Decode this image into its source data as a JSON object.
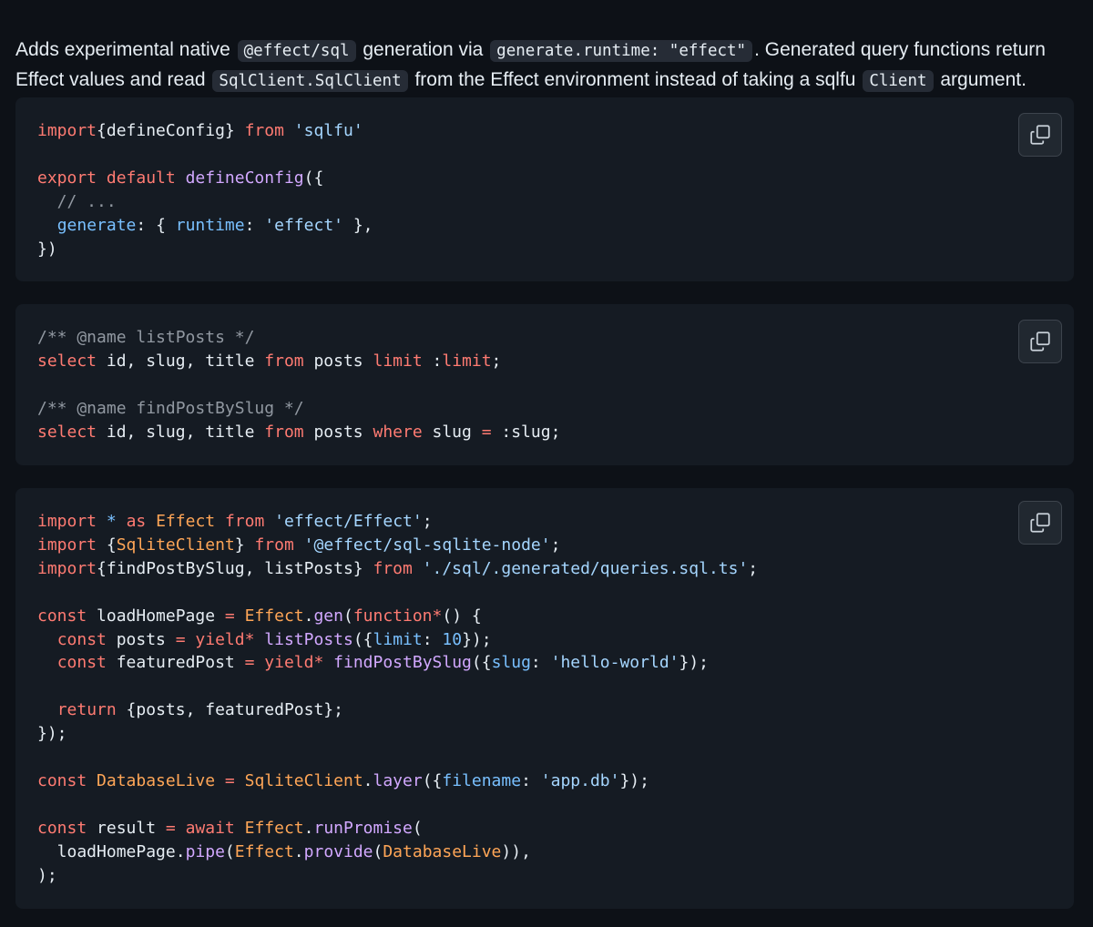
{
  "intro": {
    "t1": "Adds experimental native ",
    "c1": "@effect/sql",
    "t2": " generation via ",
    "c2": "generate.runtime: \"effect\"",
    "t3": ". Generated query functions return Effect values and read ",
    "c3": "SqlClient.SqlClient",
    "t4": " from the Effect environment instead of taking a sqlfu ",
    "c4": "Client",
    "t5": " argument."
  },
  "copy_icon": "copy-icon",
  "colors": {
    "background": "#0d1117",
    "code_block": "#151b23",
    "keyword": "#ff7b72",
    "function": "#d2a8ff",
    "string": "#a5d6ff",
    "property": "#79c0ff",
    "comment": "#9198a1",
    "class": "#ffa657"
  },
  "blocks": [
    {
      "lines": [
        [
          [
            "kw",
            "import"
          ],
          [
            "",
            "{defineConfig} "
          ],
          [
            "kw",
            "from"
          ],
          [
            "",
            " "
          ],
          [
            "str",
            "'sqlfu'"
          ]
        ],
        [],
        [
          [
            "kw",
            "export"
          ],
          [
            "",
            " "
          ],
          [
            "kw",
            "default"
          ],
          [
            "",
            " "
          ],
          [
            "fn",
            "defineConfig"
          ],
          [
            "",
            "({"
          ]
        ],
        [
          [
            "cm",
            "  // ..."
          ]
        ],
        [
          [
            "",
            "  "
          ],
          [
            "prop",
            "generate"
          ],
          [
            "",
            ": { "
          ],
          [
            "prop",
            "runtime"
          ],
          [
            "",
            ": "
          ],
          [
            "str",
            "'effect'"
          ],
          [
            "",
            " },"
          ]
        ],
        [
          [
            "",
            "})"
          ]
        ]
      ]
    },
    {
      "lines": [
        [
          [
            "cm",
            "/** @name listPosts */"
          ]
        ],
        [
          [
            "kw",
            "select"
          ],
          [
            "",
            " id, slug, title "
          ],
          [
            "kw",
            "from"
          ],
          [
            "",
            " posts "
          ],
          [
            "kw",
            "limit"
          ],
          [
            "",
            " :"
          ],
          [
            "kw",
            "limit"
          ],
          [
            "",
            ";"
          ]
        ],
        [],
        [
          [
            "cm",
            "/** @name findPostBySlug */"
          ]
        ],
        [
          [
            "kw",
            "select"
          ],
          [
            "",
            " id, slug, title "
          ],
          [
            "kw",
            "from"
          ],
          [
            "",
            " posts "
          ],
          [
            "kw",
            "where"
          ],
          [
            "",
            " slug "
          ],
          [
            "op",
            "="
          ],
          [
            "",
            " :slug;"
          ]
        ]
      ]
    },
    {
      "lines": [
        [
          [
            "kw",
            "import"
          ],
          [
            "",
            " "
          ],
          [
            "prop",
            "*"
          ],
          [
            "",
            " "
          ],
          [
            "kw",
            "as"
          ],
          [
            "",
            " "
          ],
          [
            "cls",
            "Effect"
          ],
          [
            "",
            " "
          ],
          [
            "kw",
            "from"
          ],
          [
            "",
            " "
          ],
          [
            "str",
            "'effect/Effect'"
          ],
          [
            "",
            ";"
          ]
        ],
        [
          [
            "kw",
            "import"
          ],
          [
            "",
            " {"
          ],
          [
            "cls",
            "SqliteClient"
          ],
          [
            "",
            "} "
          ],
          [
            "kw",
            "from"
          ],
          [
            "",
            " "
          ],
          [
            "str",
            "'@effect/sql-sqlite-node'"
          ],
          [
            "",
            ";"
          ]
        ],
        [
          [
            "kw",
            "import"
          ],
          [
            "",
            "{findPostBySlug, listPosts} "
          ],
          [
            "kw",
            "from"
          ],
          [
            "",
            " "
          ],
          [
            "str",
            "'./sql/.generated/queries.sql.ts'"
          ],
          [
            "",
            ";"
          ]
        ],
        [],
        [
          [
            "kw",
            "const"
          ],
          [
            "",
            " loadHomePage "
          ],
          [
            "op",
            "="
          ],
          [
            "",
            " "
          ],
          [
            "cls",
            "Effect"
          ],
          [
            "",
            "."
          ],
          [
            "fn",
            "gen"
          ],
          [
            "",
            "("
          ],
          [
            "kw",
            "function"
          ],
          [
            "op",
            "*"
          ],
          [
            "",
            "() {"
          ]
        ],
        [
          [
            "",
            "  "
          ],
          [
            "kw",
            "const"
          ],
          [
            "",
            " posts "
          ],
          [
            "op",
            "="
          ],
          [
            "",
            " "
          ],
          [
            "kw",
            "yield"
          ],
          [
            "op",
            "*"
          ],
          [
            "",
            " "
          ],
          [
            "fn",
            "listPosts"
          ],
          [
            "",
            "({"
          ],
          [
            "prop",
            "limit"
          ],
          [
            "",
            ": "
          ],
          [
            "num",
            "10"
          ],
          [
            "",
            "});"
          ]
        ],
        [
          [
            "",
            "  "
          ],
          [
            "kw",
            "const"
          ],
          [
            "",
            " featuredPost "
          ],
          [
            "op",
            "="
          ],
          [
            "",
            " "
          ],
          [
            "kw",
            "yield"
          ],
          [
            "op",
            "*"
          ],
          [
            "",
            " "
          ],
          [
            "fn",
            "findPostBySlug"
          ],
          [
            "",
            "({"
          ],
          [
            "prop",
            "slug"
          ],
          [
            "",
            ": "
          ],
          [
            "str",
            "'hello-world'"
          ],
          [
            "",
            "});"
          ]
        ],
        [],
        [
          [
            "",
            "  "
          ],
          [
            "kw",
            "return"
          ],
          [
            "",
            " {posts, featuredPost};"
          ]
        ],
        [
          [
            "",
            "});"
          ]
        ],
        [],
        [
          [
            "kw",
            "const"
          ],
          [
            "",
            " "
          ],
          [
            "cls",
            "DatabaseLive"
          ],
          [
            "",
            " "
          ],
          [
            "op",
            "="
          ],
          [
            "",
            " "
          ],
          [
            "cls",
            "SqliteClient"
          ],
          [
            "",
            "."
          ],
          [
            "fn",
            "layer"
          ],
          [
            "",
            "({"
          ],
          [
            "prop",
            "filename"
          ],
          [
            "",
            ": "
          ],
          [
            "str",
            "'app.db'"
          ],
          [
            "",
            "});"
          ]
        ],
        [],
        [
          [
            "kw",
            "const"
          ],
          [
            "",
            " result "
          ],
          [
            "op",
            "="
          ],
          [
            "",
            " "
          ],
          [
            "kw",
            "await"
          ],
          [
            "",
            " "
          ],
          [
            "cls",
            "Effect"
          ],
          [
            "",
            "."
          ],
          [
            "fn",
            "runPromise"
          ],
          [
            "",
            "("
          ]
        ],
        [
          [
            "",
            "  loadHomePage."
          ],
          [
            "fn",
            "pipe"
          ],
          [
            "",
            "("
          ],
          [
            "cls",
            "Effect"
          ],
          [
            "",
            "."
          ],
          [
            "fn",
            "provide"
          ],
          [
            "",
            "("
          ],
          [
            "cls",
            "DatabaseLive"
          ],
          [
            "",
            ")),"
          ]
        ],
        [
          [
            "",
            ");"
          ]
        ]
      ]
    }
  ]
}
